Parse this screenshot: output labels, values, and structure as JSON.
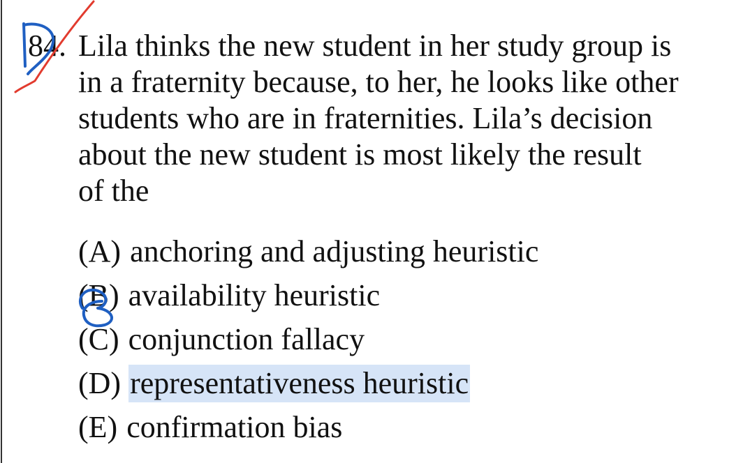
{
  "question": {
    "number": "84.",
    "stem_lines": [
      "Lila thinks the new student in her study group is",
      "in a fraternity because, to her, he looks like other",
      "students who are in fraternities. Lila’s decision",
      "about the new student is most likely the result",
      "of the"
    ]
  },
  "choices": [
    {
      "letter": "(A)",
      "text": "anchoring and adjusting heuristic"
    },
    {
      "letter": "(B)",
      "text": "availability heuristic"
    },
    {
      "letter": "(C)",
      "text": "conjunction fallacy"
    },
    {
      "letter": "(D)",
      "text": "representativeness heuristic"
    },
    {
      "letter": "(E)",
      "text": "confirmation bias"
    }
  ],
  "highlighted_choice": "(D)",
  "colors": {
    "highlight": "#d6e4f7",
    "blue_ink": "#1f5fc2",
    "red_ink": "#e23b2e"
  }
}
